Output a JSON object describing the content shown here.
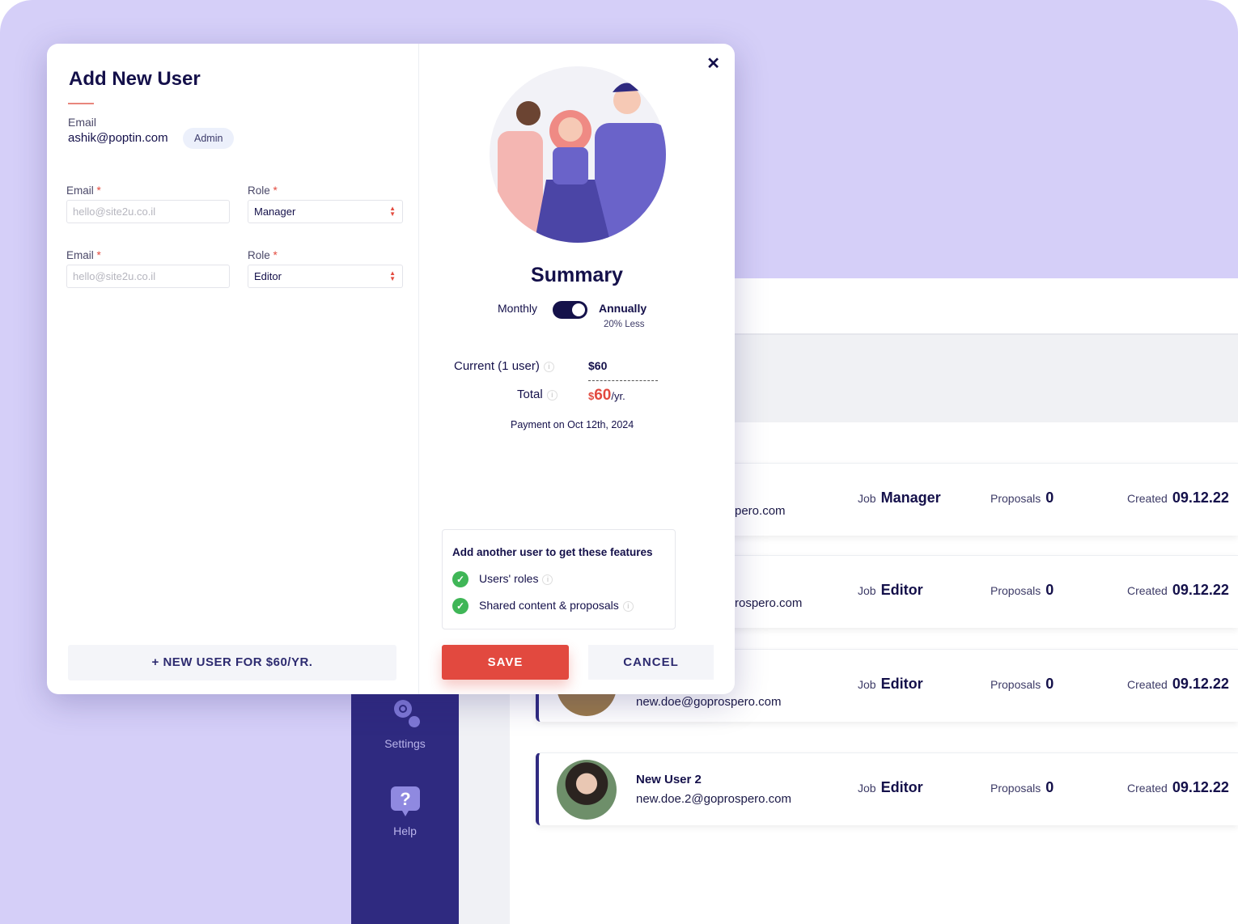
{
  "modal": {
    "title": "Add New User",
    "current_user": {
      "label": "Email",
      "email": "ashik@poptin.com",
      "role_badge": "Admin"
    },
    "rows": [
      {
        "email_label": "Email",
        "role_label": "Role",
        "required": "*",
        "email_placeholder": "hello@site2u.co.il",
        "role_value": "Manager"
      },
      {
        "email_label": "Email",
        "role_label": "Role",
        "required": "*",
        "email_placeholder": "hello@site2u.co.il",
        "role_value": "Editor"
      }
    ],
    "new_user_button": "+ NEW USER FOR $60/YR.",
    "summary": {
      "title": "Summary",
      "monthly": "Monthly",
      "annually": "Annually",
      "discount": "20% Less",
      "billing": "annually",
      "current_label": "Current (1 user)",
      "current_value": "$60",
      "total_label": "Total",
      "total_currency": "$",
      "total_value": "60",
      "total_suffix": "/yr.",
      "payment": "Payment on Oct 12th, 2024"
    },
    "features": {
      "title": "Add another user to get these features",
      "items": [
        "Users' roles",
        "Shared content & proposals"
      ]
    },
    "save": "SAVE",
    "cancel": "CANCEL"
  },
  "sidebar": {
    "items": [
      {
        "label": "Settings",
        "icon": "gear-icon"
      },
      {
        "label": "Help",
        "icon": "help-icon"
      }
    ]
  },
  "users": [
    {
      "name": "",
      "email": "pero.com",
      "job_label": "Job",
      "job": "Manager",
      "proposals_label": "Proposals",
      "proposals": "0",
      "created_label": "Created",
      "created": "09.12.22"
    },
    {
      "name": "",
      "email": "rospero.com",
      "job_label": "Job",
      "job": "Editor",
      "proposals_label": "Proposals",
      "proposals": "0",
      "created_label": "Created",
      "created": "09.12.22"
    },
    {
      "name": "",
      "email": "new.doe@goprospero.com",
      "job_label": "Job",
      "job": "Editor",
      "proposals_label": "Proposals",
      "proposals": "0",
      "created_label": "Created",
      "created": "09.12.22"
    },
    {
      "name": "New User 2",
      "email": "new.doe.2@goprospero.com",
      "job_label": "Job",
      "job": "Editor",
      "proposals_label": "Proposals",
      "proposals": "0",
      "created_label": "Created",
      "created": "09.12.22"
    }
  ],
  "colors": {
    "accent": "#2f2a80",
    "danger": "#e2493f",
    "background": "#d5cff8",
    "success": "#3fb657"
  }
}
